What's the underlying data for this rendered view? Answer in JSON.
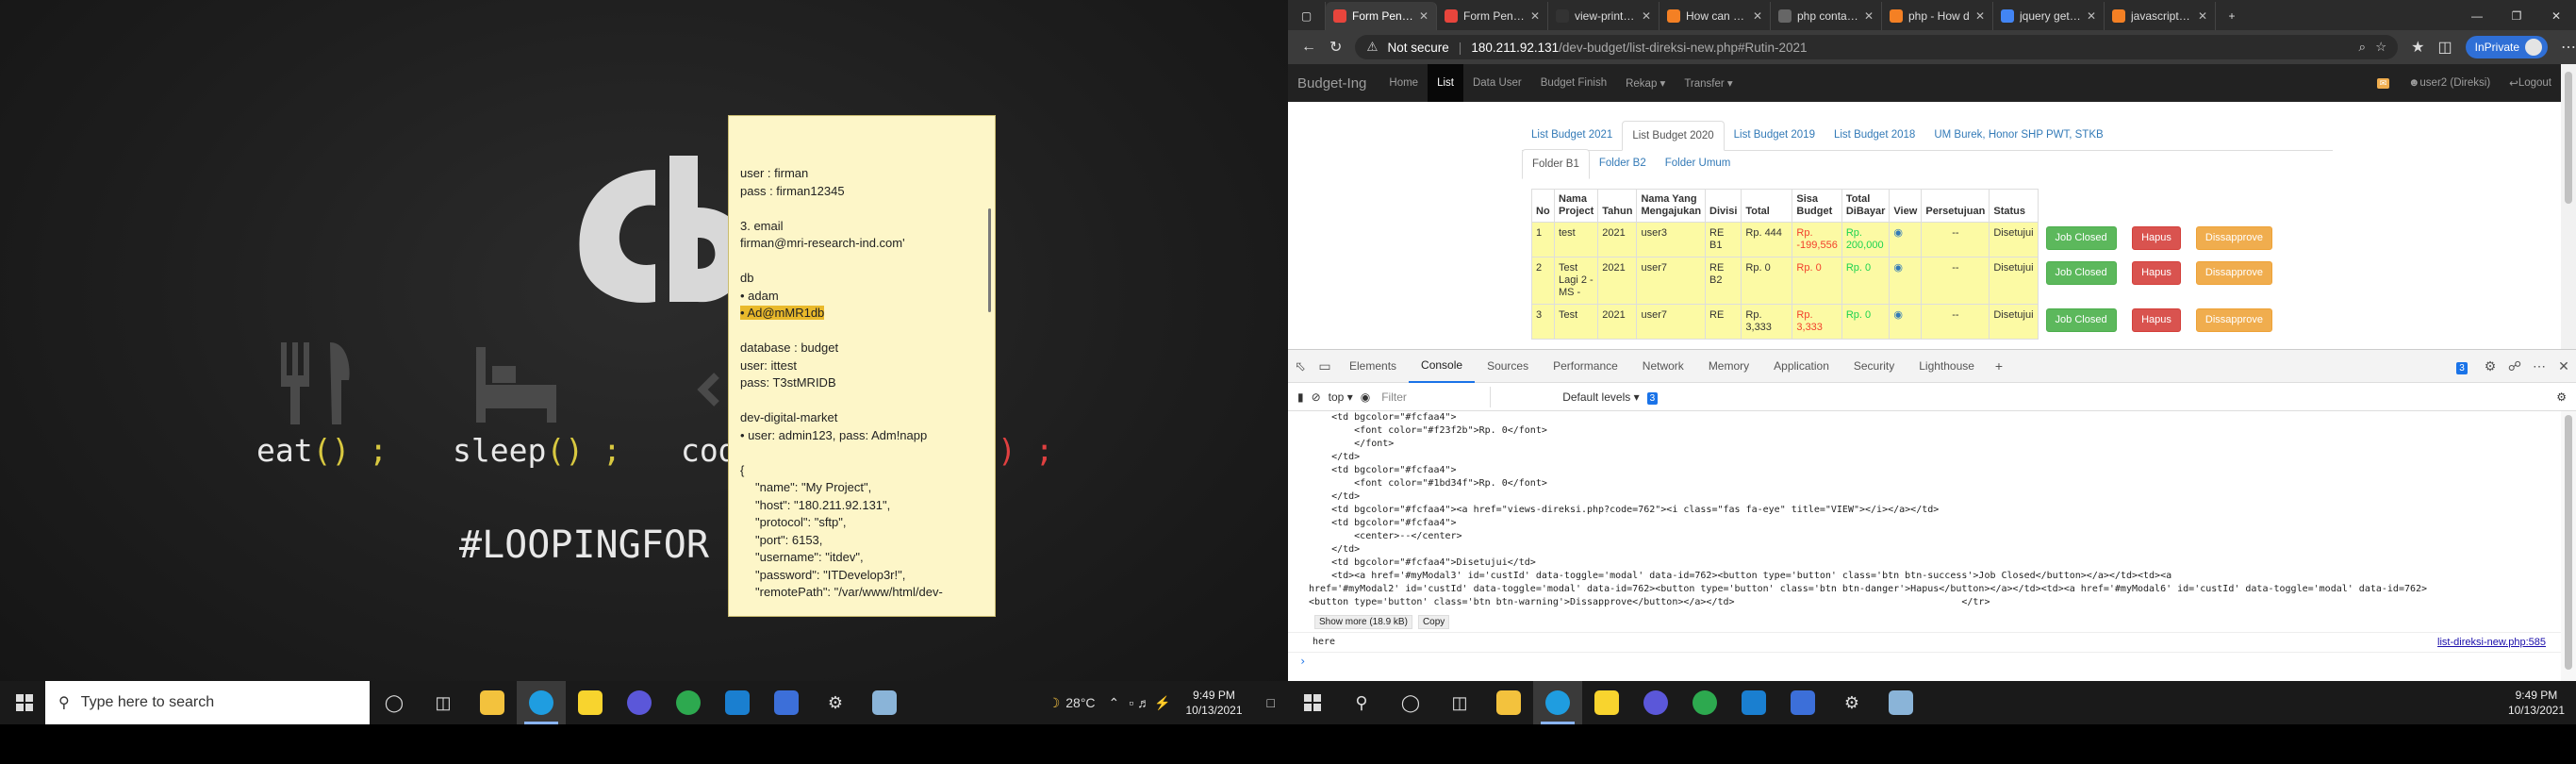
{
  "wallpaper": {
    "words": [
      "eat",
      "sleep",
      "cod"
    ],
    "punct": "() ;",
    "trail": ") ;",
    "hashtag": "#LOOPINGFOR"
  },
  "note": {
    "lines": [
      {
        "t": "user : firman"
      },
      {
        "t": "pass : firman12345"
      },
      {
        "t": ""
      },
      {
        "t": "3. email"
      },
      {
        "t": "firman@mri-research-ind.com'"
      },
      {
        "t": ""
      },
      {
        "t": "db"
      },
      {
        "t": "• adam"
      },
      {
        "t": "• Ad@mMR1db",
        "hl": true
      },
      {
        "t": ""
      },
      {
        "t": "database : budget"
      },
      {
        "t": "user: ittest"
      },
      {
        "t": "pass: T3stMRIDB"
      },
      {
        "t": ""
      },
      {
        "t": "dev-digital-market"
      },
      {
        "t": "• user: admin123, pass: Adm!napp"
      },
      {
        "t": ""
      },
      {
        "t": "{"
      },
      {
        "t": "\"name\": \"My Project\",",
        "ind": true
      },
      {
        "t": "\"host\": \"180.211.92.131\",",
        "ind": true
      },
      {
        "t": "\"protocol\": \"sftp\",",
        "ind": true
      },
      {
        "t": "\"port\": 6153,",
        "ind": true
      },
      {
        "t": "\"username\": \"itdev\",",
        "ind": true
      },
      {
        "t": "\"password\": \"ITDevelop3r!\",",
        "ind": true
      },
      {
        "t": "\"remotePath\": \"/var/www/html/dev-",
        "ind": true
      }
    ]
  },
  "taskbar_left": {
    "search_placeholder": "Type here to search",
    "weather": "28°C",
    "time": "9:49 PM",
    "date": "10/13/2021"
  },
  "taskbar_right": {
    "time": "9:49 PM",
    "date": "10/13/2021"
  },
  "browser": {
    "tabs": [
      {
        "title": "Form Pengajuan",
        "color": "#e8453c",
        "active": true
      },
      {
        "title": "Form Pengaju",
        "color": "#e8453c"
      },
      {
        "title": "view-print-by",
        "color": "#333"
      },
      {
        "title": "How can I ge",
        "color": "#f48024"
      },
      {
        "title": "php contains",
        "color": "#666"
      },
      {
        "title": "php - How d",
        "color": "#f48024"
      },
      {
        "title": "jquery get on",
        "color": "#4285f4"
      },
      {
        "title": "javascript - Sa",
        "color": "#f48024"
      }
    ],
    "not_secure": "Not secure",
    "url_host": "180.211.92.131",
    "url_path": "/dev-budget/list-direksi-new.php#Rutin-2021",
    "inprivate": "InPrivate"
  },
  "site": {
    "brand": "Budget-Ing",
    "nav": [
      "Home",
      "List",
      "Data User",
      "Budget Finish",
      "Rekap ▾",
      "Transfer ▾"
    ],
    "active_nav": 1,
    "user": "user2 (Direksi)",
    "logout": "Logout",
    "tabs1": [
      "List Budget 2021",
      "List Budget 2020",
      "List Budget 2019",
      "List Budget 2018",
      "UM Burek, Honor SHP PWT, STKB"
    ],
    "active_tab1": 1,
    "tabs2": [
      "Folder B1",
      "Folder B2",
      "Folder Umum"
    ],
    "active_tab2": 0
  },
  "table": {
    "headers": [
      "No",
      "Nama Project",
      "Tahun",
      "Nama Yang Mengajukan",
      "Divisi",
      "Total",
      "Sisa Budget",
      "Total DiBayar",
      "View",
      "Persetujuan",
      "Status"
    ],
    "rows": [
      {
        "no": "1",
        "project": "test",
        "tahun": "2021",
        "nama": "user3",
        "divisi": "RE B1",
        "total": "Rp. 444",
        "sisa": "Rp. -199,556",
        "bayar": "Rp. 200,000",
        "persetujuan": "--",
        "status": "Disetujui"
      },
      {
        "no": "2",
        "project": "Test Lagi 2 - MS -",
        "tahun": "2021",
        "nama": "user7",
        "divisi": "RE B2",
        "total": "Rp. 0",
        "sisa": "Rp. 0",
        "bayar": "Rp. 0",
        "persetujuan": "--",
        "status": "Disetujui"
      },
      {
        "no": "3",
        "project": "Test",
        "tahun": "2021",
        "nama": "user7",
        "divisi": "RE",
        "total": "Rp. 3,333",
        "sisa": "Rp. 3,333",
        "bayar": "Rp. 0",
        "persetujuan": "--",
        "status": "Disetujui"
      }
    ],
    "btn_closed": "Job Closed",
    "btn_hapus": "Hapus",
    "btn_dissaprove": "Dissapprove"
  },
  "devtools": {
    "tabs": [
      "Elements",
      "Console",
      "Sources",
      "Performance",
      "Network",
      "Memory",
      "Application",
      "Security",
      "Lighthouse"
    ],
    "active": 1,
    "badge": "3",
    "context": "top",
    "filter_placeholder": "Filter",
    "levels": "Default levels",
    "code": "    <td bgcolor=\"#fcfaa4\">\n        <font color=\"#f23f2b\">Rp. 0</font>\n        </font>\n    </td>\n    <td bgcolor=\"#fcfaa4\">\n        <font color=\"#1bd34f\">Rp. 0</font>\n    </td>\n    <td bgcolor=\"#fcfaa4\"><a href=\"views-direksi.php?code=762\"><i class=\"fas fa-eye\" title=\"VIEW\"></i></a></td>\n    <td bgcolor=\"#fcfaa4\">\n        <center>--</center>\n    </td>\n    <td bgcolor=\"#fcfaa4\">Disetujui</td>\n    <td><a href='#myModal3' id='custId' data-toggle='modal' data-id=762><button type='button' class='btn btn-success'>Job Closed</button></a></td><td><a\nhref='#myModal2' id='custId' data-toggle='modal' data-id=762><button type='button' class='btn btn-danger'>Hapus</button></a></td><td><a href='#myModal6' id='custId' data-toggle='modal' data-id=762>\n<button type='button' class='btn btn-warning'>Dissapprove</button></a></td>                                        </tr>",
    "show_more": "Show more (18.9 kB)",
    "copy": "Copy",
    "log_msg": "here",
    "log_src": "list-direksi-new.php:585"
  }
}
